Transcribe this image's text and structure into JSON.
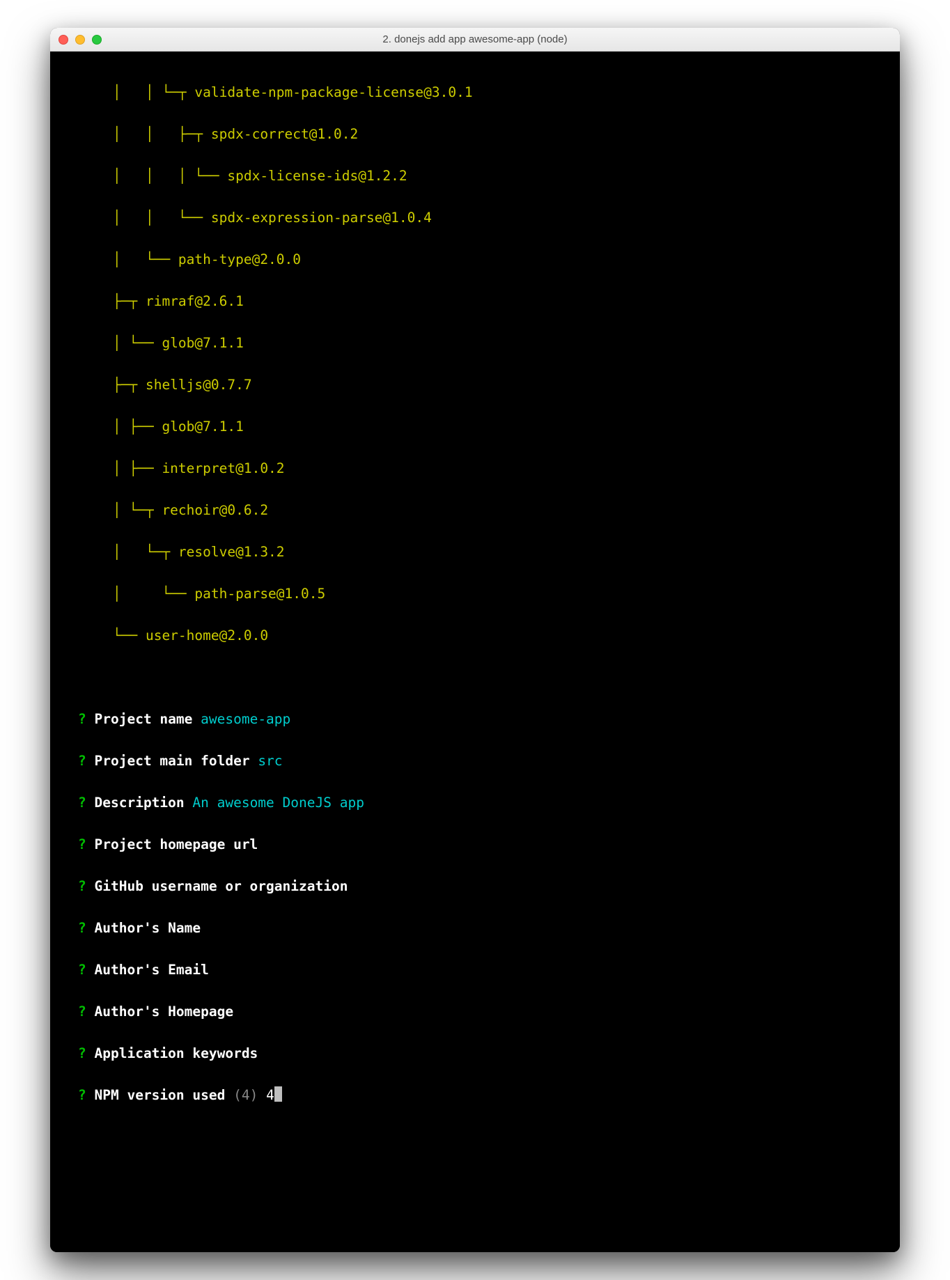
{
  "window": {
    "title": "2. donejs add app awesome-app (node)"
  },
  "tree": [
    "│   │ └─┬ validate-npm-package-license@3.0.1",
    "│   │   ├─┬ spdx-correct@1.0.2",
    "│   │   │ └── spdx-license-ids@1.2.2",
    "│   │   └── spdx-expression-parse@1.0.4",
    "│   └── path-type@2.0.0",
    "├─┬ rimraf@2.6.1",
    "│ └── glob@7.1.1",
    "├─┬ shelljs@0.7.7",
    "│ ├── glob@7.1.1",
    "│ ├── interpret@1.0.2",
    "│ └─┬ rechoir@0.6.2",
    "│   └─┬ resolve@1.3.2",
    "│     └── path-parse@1.0.5",
    "└── user-home@2.0.0"
  ],
  "prompts": [
    {
      "label": "Project name",
      "answer": "awesome-app"
    },
    {
      "label": "Project main folder",
      "answer": "src"
    },
    {
      "label": "Description",
      "answer": "An awesome DoneJS app"
    },
    {
      "label": "Project homepage url",
      "answer": ""
    },
    {
      "label": "GitHub username or organization",
      "answer": ""
    },
    {
      "label": "Author's Name",
      "answer": ""
    },
    {
      "label": "Author's Email",
      "answer": ""
    },
    {
      "label": "Author's Homepage",
      "answer": ""
    },
    {
      "label": "Application keywords",
      "answer": ""
    }
  ],
  "current": {
    "label": "NPM version used",
    "hint": "(4)",
    "input": "4"
  },
  "colors": {
    "tree": "#cdcd00",
    "question": "#00bf00",
    "answer": "#00cdcd",
    "hint": "#888888",
    "bg": "#000000"
  }
}
